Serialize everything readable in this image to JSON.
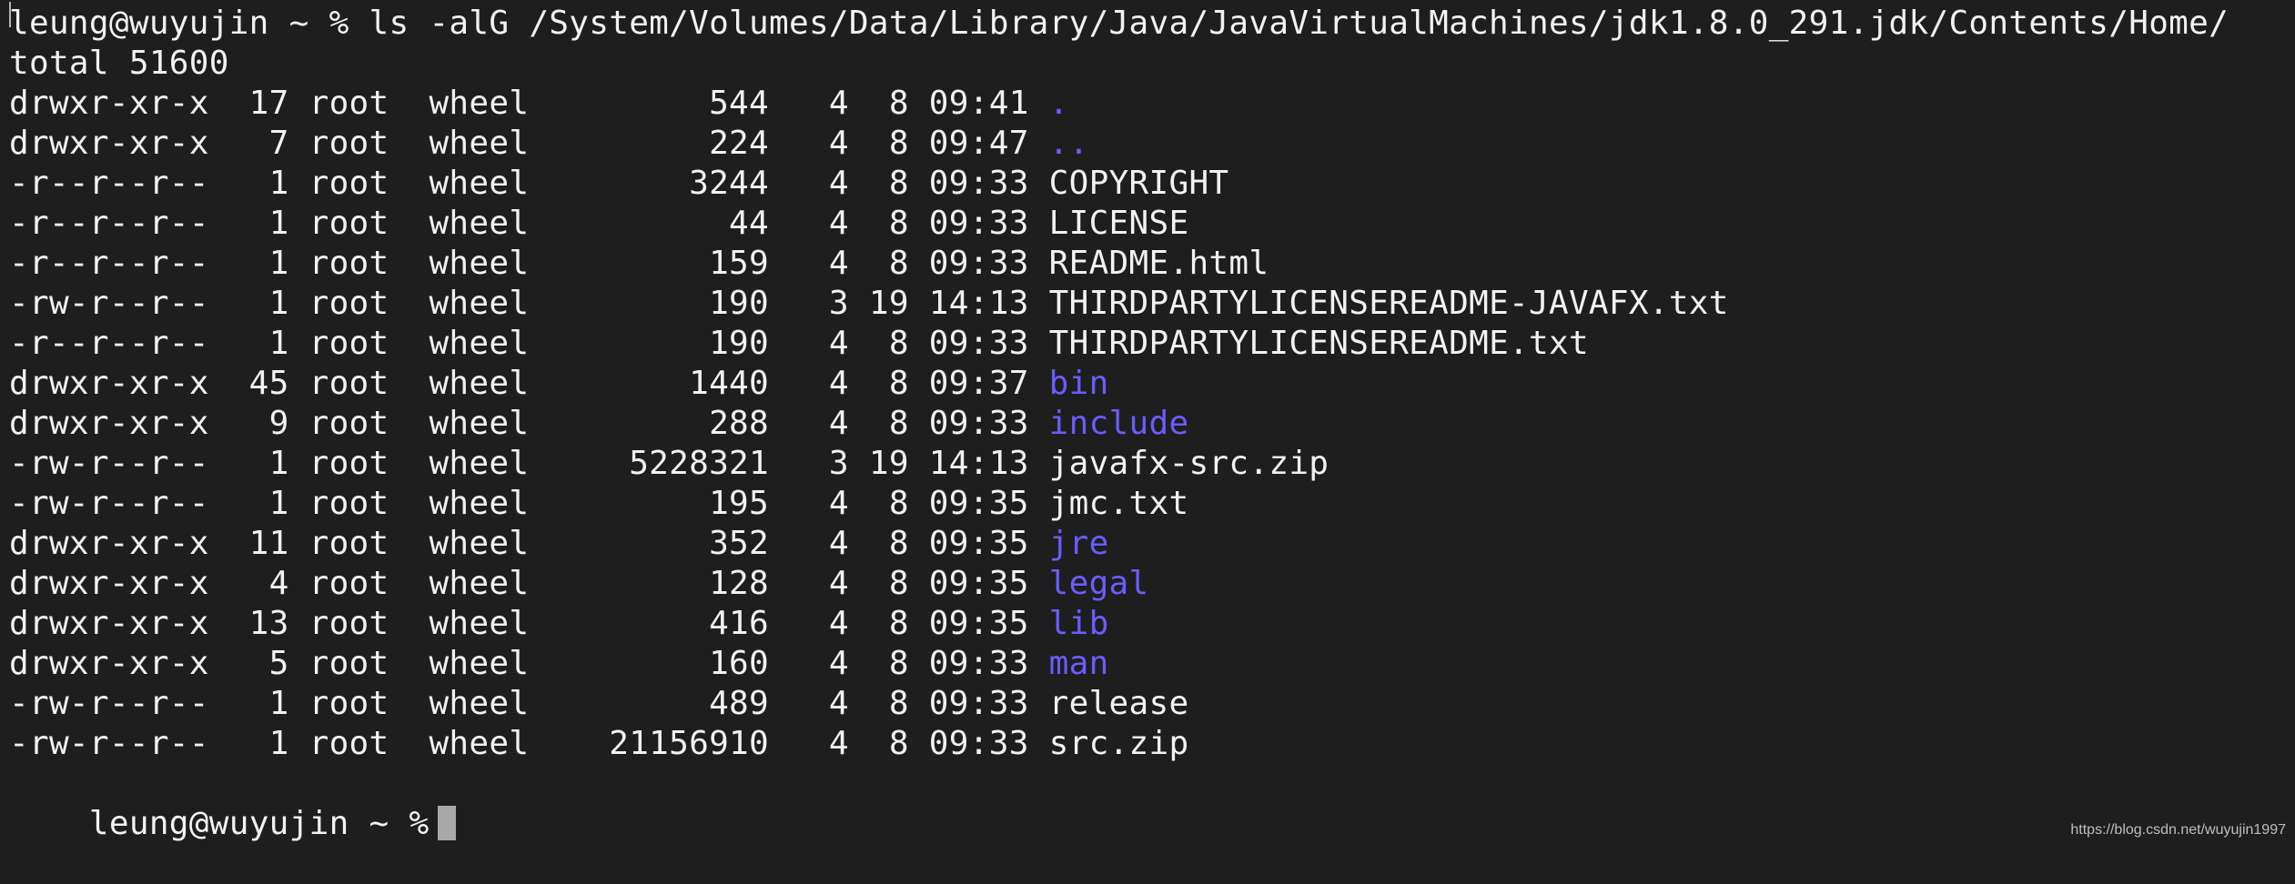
{
  "terminal": {
    "command_line": "leung@wuyujin ~ % ls -alG /System/Volumes/Data/Library/Java/JavaVirtualMachines/jdk1.8.0_291.jdk/Contents/Home/",
    "total": "total 51600",
    "rows": [
      {
        "perm": "drwxr-xr-x",
        "links": "17",
        "owner": "root",
        "group": "wheel",
        "size": "544",
        "month": "4",
        "day": "8",
        "time": "09:41",
        "name": ".",
        "is_dir": true
      },
      {
        "perm": "drwxr-xr-x",
        "links": "7",
        "owner": "root",
        "group": "wheel",
        "size": "224",
        "month": "4",
        "day": "8",
        "time": "09:47",
        "name": "..",
        "is_dir": true
      },
      {
        "perm": "-r--r--r--",
        "links": "1",
        "owner": "root",
        "group": "wheel",
        "size": "3244",
        "month": "4",
        "day": "8",
        "time": "09:33",
        "name": "COPYRIGHT",
        "is_dir": false
      },
      {
        "perm": "-r--r--r--",
        "links": "1",
        "owner": "root",
        "group": "wheel",
        "size": "44",
        "month": "4",
        "day": "8",
        "time": "09:33",
        "name": "LICENSE",
        "is_dir": false
      },
      {
        "perm": "-r--r--r--",
        "links": "1",
        "owner": "root",
        "group": "wheel",
        "size": "159",
        "month": "4",
        "day": "8",
        "time": "09:33",
        "name": "README.html",
        "is_dir": false
      },
      {
        "perm": "-rw-r--r--",
        "links": "1",
        "owner": "root",
        "group": "wheel",
        "size": "190",
        "month": "3",
        "day": "19",
        "time": "14:13",
        "name": "THIRDPARTYLICENSEREADME-JAVAFX.txt",
        "is_dir": false
      },
      {
        "perm": "-r--r--r--",
        "links": "1",
        "owner": "root",
        "group": "wheel",
        "size": "190",
        "month": "4",
        "day": "8",
        "time": "09:33",
        "name": "THIRDPARTYLICENSEREADME.txt",
        "is_dir": false
      },
      {
        "perm": "drwxr-xr-x",
        "links": "45",
        "owner": "root",
        "group": "wheel",
        "size": "1440",
        "month": "4",
        "day": "8",
        "time": "09:37",
        "name": "bin",
        "is_dir": true
      },
      {
        "perm": "drwxr-xr-x",
        "links": "9",
        "owner": "root",
        "group": "wheel",
        "size": "288",
        "month": "4",
        "day": "8",
        "time": "09:33",
        "name": "include",
        "is_dir": true
      },
      {
        "perm": "-rw-r--r--",
        "links": "1",
        "owner": "root",
        "group": "wheel",
        "size": "5228321",
        "month": "3",
        "day": "19",
        "time": "14:13",
        "name": "javafx-src.zip",
        "is_dir": false
      },
      {
        "perm": "-rw-r--r--",
        "links": "1",
        "owner": "root",
        "group": "wheel",
        "size": "195",
        "month": "4",
        "day": "8",
        "time": "09:35",
        "name": "jmc.txt",
        "is_dir": false
      },
      {
        "perm": "drwxr-xr-x",
        "links": "11",
        "owner": "root",
        "group": "wheel",
        "size": "352",
        "month": "4",
        "day": "8",
        "time": "09:35",
        "name": "jre",
        "is_dir": true
      },
      {
        "perm": "drwxr-xr-x",
        "links": "4",
        "owner": "root",
        "group": "wheel",
        "size": "128",
        "month": "4",
        "day": "8",
        "time": "09:35",
        "name": "legal",
        "is_dir": true
      },
      {
        "perm": "drwxr-xr-x",
        "links": "13",
        "owner": "root",
        "group": "wheel",
        "size": "416",
        "month": "4",
        "day": "8",
        "time": "09:35",
        "name": "lib",
        "is_dir": true
      },
      {
        "perm": "drwxr-xr-x",
        "links": "5",
        "owner": "root",
        "group": "wheel",
        "size": "160",
        "month": "4",
        "day": "8",
        "time": "09:33",
        "name": "man",
        "is_dir": true
      },
      {
        "perm": "-rw-r--r--",
        "links": "1",
        "owner": "root",
        "group": "wheel",
        "size": "489",
        "month": "4",
        "day": "8",
        "time": "09:33",
        "name": "release",
        "is_dir": false
      },
      {
        "perm": "-rw-r--r--",
        "links": "1",
        "owner": "root",
        "group": "wheel",
        "size": "21156910",
        "month": "4",
        "day": "8",
        "time": "09:33",
        "name": "src.zip",
        "is_dir": false
      }
    ],
    "prompt": "leung@wuyujin ~ %"
  },
  "watermark": {
    "text": "https://blog.csdn.net/wuyujin1997"
  },
  "colors": {
    "background": "#1e1e1e",
    "text": "#f2f2f2",
    "directory": "#6b5cff",
    "cursor": "#a9a9a9"
  }
}
